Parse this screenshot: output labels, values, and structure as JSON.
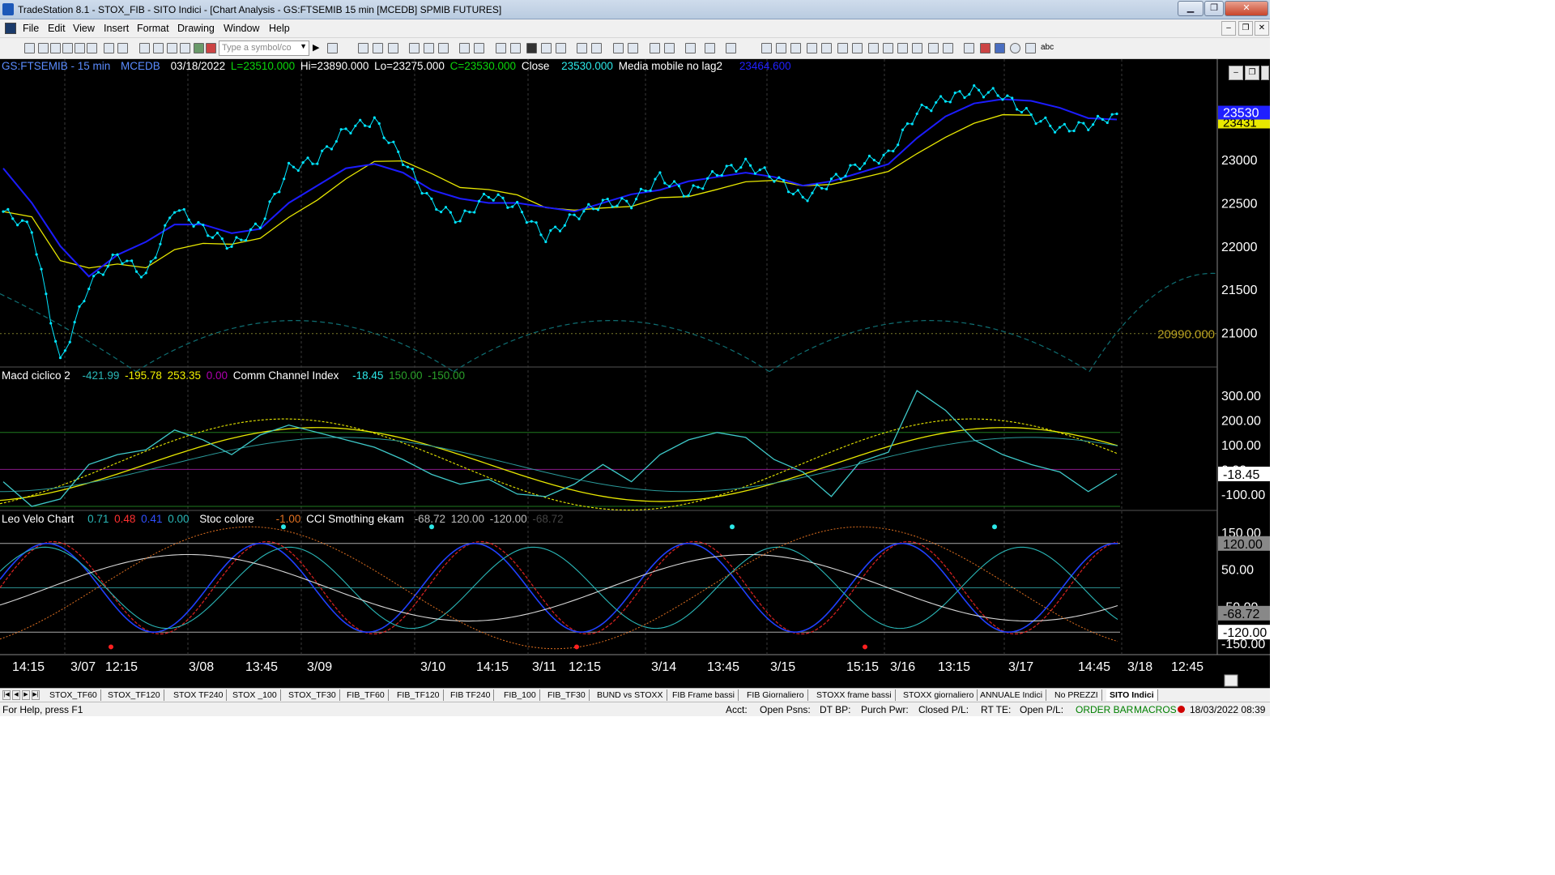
{
  "window": {
    "title": "TradeStation 8.1 - STOX_FIB - SITO Indici - [Chart Analysis - GS:FTSEMIB  15 min  [MCEDB] SPMIB FUTURES]",
    "minimize": "▁",
    "maximize": "❐",
    "close": "✕",
    "mdi_minimize": "–",
    "mdi_restore": "❐",
    "mdi_close": "✕"
  },
  "menu": [
    "File",
    "Edit",
    "View",
    "Insert",
    "Format",
    "Drawing",
    "Window",
    "Help"
  ],
  "toolbar": {
    "symbol_placeholder": "Type a symbol/co",
    "abc": "abc"
  },
  "chart": {
    "main_header": {
      "symbol": "GS:FTSEMIB - 15 min",
      "session": "MCEDB",
      "date": "03/18/2022",
      "low_label": "L=23510.000",
      "hi": "Hi=23890.000",
      "lo": "Lo=23275.000",
      "close_label": "C=23530.000",
      "close_word": "Close",
      "close_val": "23530.000",
      "ma_name": "Media mobile no lag2",
      "ma_val": "23464.600"
    },
    "price_axis": [
      "23000",
      "22500",
      "22000",
      "21500",
      "21000"
    ],
    "last_price_tag": "23530",
    "ma_tag": "23431",
    "cycle_label": "20990.000",
    "macd_header": {
      "name": "Macd ciclico 2",
      "v1": "-421.99",
      "v2": "-195.78",
      "v3": "253.35",
      "v4": "0.00",
      "cci_name": "Comm Channel Index",
      "cci_val": "-18.45",
      "cci_hi": "150.00",
      "cci_lo": "-150.00"
    },
    "macd_axis": [
      "300.00",
      "200.00",
      "100.00",
      "0.00",
      "-100.00"
    ],
    "cci_tag": "-18.45",
    "velo_header": {
      "name": "Leo Velo Chart",
      "v1": "0.71",
      "v2": "0.48",
      "v3": "0.41",
      "v4": "0.00",
      "stoc_name": "Stoc colore",
      "stoc_val": "-1.00",
      "cci_s_name": "CCI Smothing ekam",
      "cci_s_val": "-68.72",
      "cci_s_hi": "120.00",
      "cci_s_lo": "-120.00",
      "cci_s_last": "-68.72"
    },
    "velo_axis": [
      "150.00",
      "50.00",
      "-50.00",
      "-150.00"
    ],
    "velo_tags": [
      "120.00",
      "-68.72",
      "-120.00"
    ],
    "time_axis": [
      "14:15",
      "3/07",
      "12:15",
      "3/08",
      "13:45",
      "3/09",
      "3/10",
      "14:15",
      "3/11",
      "12:15",
      "3/14",
      "13:45",
      "3/15",
      "15:15",
      "3/16",
      "13:15",
      "3/17",
      "14:45",
      "3/18",
      "12:45"
    ],
    "colors": {
      "background": "#000000",
      "price_dots": "#00e5ff",
      "ma_fast": "#1c1cff",
      "ma_slow": "#e8e800",
      "cci": "#3ec9c9",
      "dash_cycle": "#0f6e72"
    },
    "chart_data": {
      "type": "line",
      "x": [
        "3/04 14:15",
        "3/07 09:00",
        "3/07 10:00",
        "3/07 12:15",
        "3/07 15:00",
        "3/08 09:00",
        "3/08 11:00",
        "3/08 13:45",
        "3/08 16:00",
        "3/09 09:00",
        "3/09 11:00",
        "3/09 13:00",
        "3/09 15:00",
        "3/09 17:00",
        "3/10 09:00",
        "3/10 11:00",
        "3/10 14:15",
        "3/10 16:30",
        "3/11 09:00",
        "3/11 10:30",
        "3/11 12:15",
        "3/11 15:00",
        "3/11 17:00",
        "3/14 09:30",
        "3/14 11:00",
        "3/14 13:45",
        "3/14 16:00",
        "3/15 09:00",
        "3/15 11:00",
        "3/15 13:00",
        "3/15 15:15",
        "3/15 17:00",
        "3/16 09:30",
        "3/16 11:00",
        "3/16 13:15",
        "3/16 16:00",
        "3/17 09:00",
        "3/17 11:00",
        "3/17 14:45",
        "3/17 16:30"
      ],
      "series": [
        {
          "name": "Close",
          "values": [
            22400,
            22200,
            20650,
            21550,
            21900,
            21650,
            22450,
            22200,
            22000,
            22250,
            22900,
            23000,
            23350,
            23450,
            23000,
            22500,
            22300,
            22600,
            22450,
            22100,
            22350,
            22500,
            22500,
            22800,
            22600,
            22850,
            22950,
            22800,
            22550,
            22750,
            22950,
            23050,
            23550,
            23700,
            23800,
            23750,
            23500,
            23350,
            23400,
            23530
          ]
        },
        {
          "name": "Media mobile no lag2",
          "values": [
            22900,
            22500,
            22000,
            21650,
            21900,
            22050,
            22250,
            22250,
            22150,
            22200,
            22500,
            22700,
            22900,
            22950,
            22850,
            22650,
            22550,
            22500,
            22500,
            22450,
            22400,
            22500,
            22600,
            22650,
            22750,
            22800,
            22850,
            22800,
            22700,
            22750,
            22850,
            22950,
            23250,
            23500,
            23650,
            23700,
            23680,
            23600,
            23480,
            23464.6
          ]
        },
        {
          "name": "Comm Channel Index",
          "values": [
            -50,
            -150,
            -120,
            20,
            60,
            80,
            160,
            120,
            60,
            140,
            180,
            150,
            120,
            90,
            40,
            -20,
            -60,
            -40,
            -100,
            -110,
            -60,
            20,
            -50,
            60,
            120,
            150,
            130,
            40,
            -10,
            -110,
            30,
            70,
            320,
            240,
            120,
            60,
            20,
            -10,
            -90,
            -18.45
          ]
        }
      ],
      "ylim": [
        20650,
        23900
      ]
    }
  },
  "tabs": [
    "STOX_TF60",
    "STOX_TF120",
    "STOX TF240",
    "STOX _100",
    "STOX_TF30",
    "FIB_TF60",
    "FIB_TF120",
    "FIB TF240",
    "FIB_100",
    "FIB_TF30",
    "BUND vs STOXX",
    "FIB Frame bassi",
    "FIB Giornaliero",
    "STOXX frame bassi",
    "STOXX giornaliero",
    "ANNUALE Indici",
    "No PREZZI",
    "SITO Indici"
  ],
  "status": {
    "help": "For Help, press F1",
    "acct": "Acct:",
    "open_psns": "Open Psns:",
    "dt_bp": "DT BP:",
    "purch_pwr": "Purch Pwr:",
    "closed_pl": "Closed P/L:",
    "rt_te": "RT TE:",
    "open_pl": "Open P/L:",
    "order_bar": "ORDER BAR",
    "macros": "MACROS",
    "datetime": "18/03/2022 08:39"
  }
}
